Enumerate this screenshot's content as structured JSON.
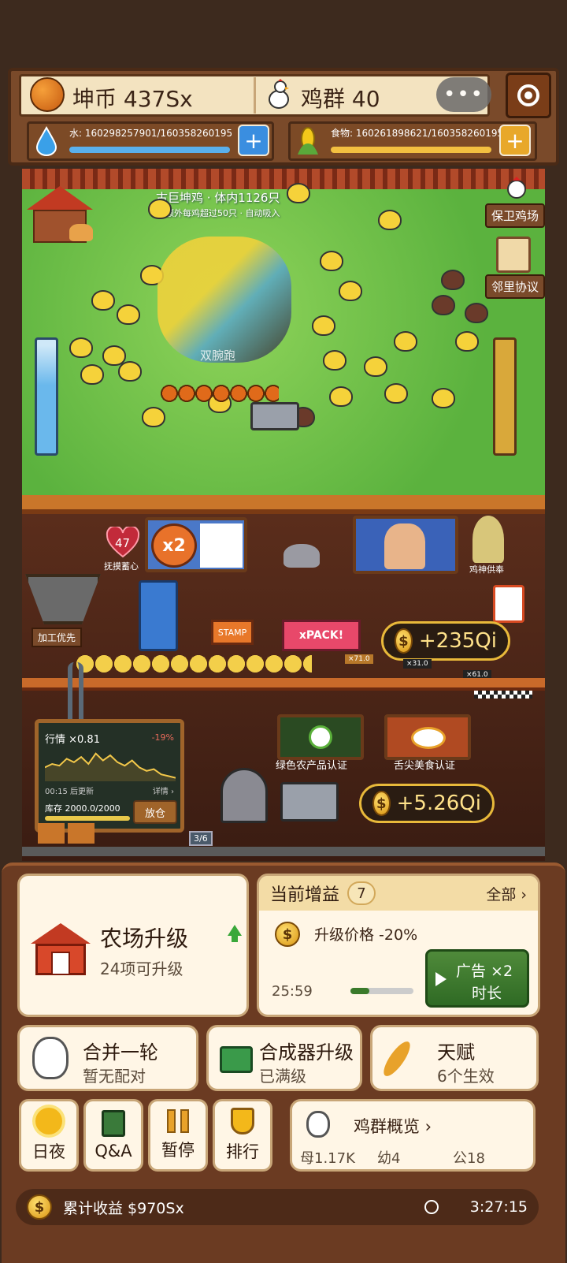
{
  "header": {
    "coins_label": "坤币 437Sx",
    "flock_label": "鸡群 40",
    "menu_glyph": "•••",
    "water_label": "水: 160298257901/160358260195",
    "water_fraction": 0.9996,
    "food_label": "食物: 160261898621/160358260195",
    "food_fraction": 0.9994,
    "plus_glyph": "+"
  },
  "scene": {
    "boss_title": "古巨坤鸡 · 体内1126只",
    "boss_sub": "额外每鸡超过50只 · 自动吸入",
    "boss_overlay": "双腕跑",
    "defend_button": "保卫鸡场",
    "pact_button": "邻里协议"
  },
  "factory": {
    "pet_count": "47",
    "pet_label": "抚摸蓄心",
    "multiplier": "x2",
    "god_label": "鸡神供奉",
    "processing_priority": "加工优先",
    "stamp_label": "STAMP",
    "pack_label": "xPACK!",
    "earn_1": "+235Qi",
    "earn_2": "+5.26Qi",
    "tag_1": "×71.0",
    "tag_2": "×31.0",
    "tag_3": "×61.0",
    "cert_green": "绿色农产品认证",
    "cert_food": "舌尖美食认证",
    "market_title": "行情 ×0.81",
    "market_change": "-19%",
    "market_update": "00:15 后更新",
    "market_detail": "详情 ›",
    "market_stock": "库存 2000.0/2000",
    "market_button": "放仓",
    "market_points": [
      0.6,
      0.5,
      0.55,
      0.35,
      0.45,
      0.3,
      0.5,
      0.2,
      0.4,
      0.25,
      0.45,
      0.55,
      0.4,
      0.6,
      0.7,
      0.65,
      0.8,
      0.85,
      0.9
    ],
    "queue": "3/6"
  },
  "bottom": {
    "farm_upgrade_title": "农场升级",
    "farm_upgrade_sub": "24项可升级",
    "boost_title": "当前增益",
    "boost_count": "7",
    "boost_all": "全部 ›",
    "boost_item": "升级价格 -20%",
    "boost_timer": "25:59",
    "boost_progress": 0.3,
    "ad_line1": "广告 ×2",
    "ad_line2": "时长",
    "merge_title": "合并一轮",
    "merge_sub": "暂无配对",
    "synth_title": "合成器升级",
    "synth_sub": "已满级",
    "talent_title": "天赋",
    "talent_sub": "6个生效",
    "daynight": "日夜",
    "qa": "Q&A",
    "pause": "暂停",
    "rank": "排行",
    "flock_overview": "鸡群概览 ›",
    "hens": "母1.17K",
    "chicks": "幼4",
    "roosters": "公18",
    "total_earnings": "累计收益  $970Sx",
    "clock": "3:27:15"
  }
}
